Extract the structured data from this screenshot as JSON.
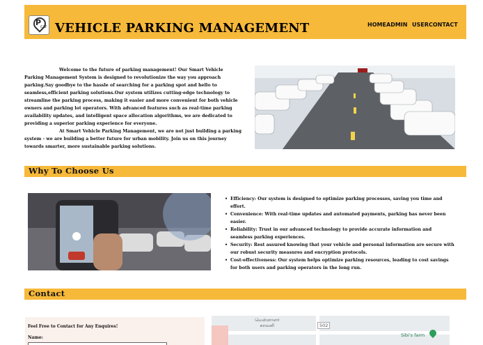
{
  "header": {
    "title": "VEHICLE PARKING MANAGEMENT",
    "logo_letter": "P",
    "logo_sub": "car",
    "nav": [
      "HOME",
      "ADMIN",
      "USER",
      "CONTACT"
    ]
  },
  "intro": {
    "p1": "Welcome to the future of parking management! Our Smart Vehicle Parking Management System is designed to revolutionize the way you approach parking.Say goodbye to the hassle of searching for a parking spot and hello to seamless,efficient parking solutions.Our system utilizes cutting-edge technology to streamline the parking process, making it easier and more convenient for both vehicle owners and parking lot operators. With advanced features such as real-time parking availability updates, and intelligent space allocation algorithms, we are dedicated to providing a superior parking experience for everyone.",
    "p2": "At Smart Vehicle Parking Management, we are not just building a parking system - we are building a better future for urban mobility. Join us on this journey towards smarter, more sustainable parking solutions."
  },
  "why": {
    "heading": "Why To Choose Us",
    "items": [
      "Efficiency: Our system is designed to optimize parking processes, saving you time and effort.",
      "Convenience: With real-time updates and automated payments, parking has never been easier.",
      "Reliability: Trust in our advanced technology to provide accurate information and seamless parking experiences.",
      "Security: Rest assured knowing that your vehicle and personal information are secure with our robust security measures and encryption protocols.",
      "Cost-effectiveness: Our system helps optimize parking resources, leading to cost savings for both users and parking operators in the long run."
    ]
  },
  "contact": {
    "heading": "Contact",
    "form_title": "Feel Free to Contact for Any Enquires!",
    "name_label": "Name:"
  },
  "map": {
    "label1": "வெள்ளாளர்\nகாலனி",
    "label2": "Sibi's farm",
    "road": "502"
  },
  "colors": {
    "accent": "#f7b93a"
  }
}
